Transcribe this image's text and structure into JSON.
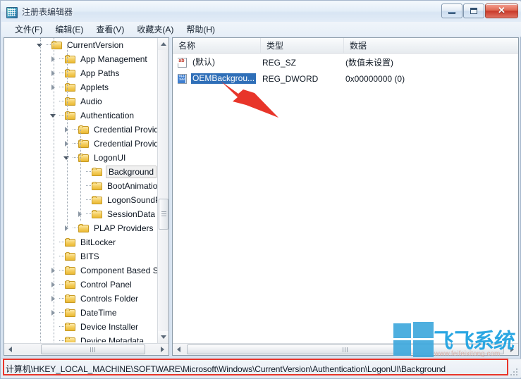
{
  "window": {
    "title": "注册表编辑器",
    "icon": "regedit-icon",
    "buttons": {
      "minimize": "最小化",
      "maximize": "最大化",
      "close": "✕"
    }
  },
  "menubar": {
    "items": [
      {
        "label": "文件(F)",
        "name": "menu-file"
      },
      {
        "label": "编辑(E)",
        "name": "menu-edit"
      },
      {
        "label": "查看(V)",
        "name": "menu-view"
      },
      {
        "label": "收藏夹(A)",
        "name": "menu-favorites"
      },
      {
        "label": "帮助(H)",
        "name": "menu-help"
      }
    ]
  },
  "tree": {
    "nodes": [
      {
        "label": "CurrentVersion",
        "depth": 1,
        "state": "expanded",
        "selected": false
      },
      {
        "label": "App Management",
        "depth": 2,
        "state": "collapsed",
        "selected": false
      },
      {
        "label": "App Paths",
        "depth": 2,
        "state": "collapsed",
        "selected": false
      },
      {
        "label": "Applets",
        "depth": 2,
        "state": "collapsed",
        "selected": false
      },
      {
        "label": "Audio",
        "depth": 2,
        "state": "leaf",
        "selected": false
      },
      {
        "label": "Authentication",
        "depth": 2,
        "state": "expanded",
        "selected": false
      },
      {
        "label": "Credential Provid",
        "depth": 3,
        "state": "collapsed",
        "selected": false
      },
      {
        "label": "Credential Provid",
        "depth": 3,
        "state": "collapsed",
        "selected": false
      },
      {
        "label": "LogonUI",
        "depth": 3,
        "state": "expanded",
        "selected": false
      },
      {
        "label": "Background",
        "depth": 4,
        "state": "leaf",
        "selected": true
      },
      {
        "label": "BootAnimatio",
        "depth": 4,
        "state": "leaf",
        "selected": false
      },
      {
        "label": "LogonSoundP",
        "depth": 4,
        "state": "leaf",
        "selected": false
      },
      {
        "label": "SessionData",
        "depth": 4,
        "state": "collapsed",
        "selected": false
      },
      {
        "label": "PLAP Providers",
        "depth": 3,
        "state": "collapsed",
        "selected": false
      },
      {
        "label": "BitLocker",
        "depth": 2,
        "state": "leaf",
        "selected": false
      },
      {
        "label": "BITS",
        "depth": 2,
        "state": "leaf",
        "selected": false
      },
      {
        "label": "Component Based S",
        "depth": 2,
        "state": "collapsed",
        "selected": false
      },
      {
        "label": "Control Panel",
        "depth": 2,
        "state": "collapsed",
        "selected": false
      },
      {
        "label": "Controls Folder",
        "depth": 2,
        "state": "collapsed",
        "selected": false
      },
      {
        "label": "DateTime",
        "depth": 2,
        "state": "collapsed",
        "selected": false
      },
      {
        "label": "Device Installer",
        "depth": 2,
        "state": "leaf",
        "selected": false
      },
      {
        "label": "Device Metadata",
        "depth": 2,
        "state": "leaf",
        "selected": false
      }
    ]
  },
  "listview": {
    "columns": [
      {
        "label": "名称",
        "name": "column-name"
      },
      {
        "label": "类型",
        "name": "column-type"
      },
      {
        "label": "数据",
        "name": "column-data"
      }
    ],
    "rows": [
      {
        "icon": "string-value-icon",
        "icon_text": "ab",
        "name": "(默认)",
        "type": "REG_SZ",
        "data": "(数值未设置)",
        "selected": false
      },
      {
        "icon": "dword-value-icon",
        "icon_text": "011 100",
        "name": "OEMBackgrou...",
        "type": "REG_DWORD",
        "data": "0x00000000 (0)",
        "selected": true
      }
    ]
  },
  "statusbar": {
    "path": "计算机\\HKEY_LOCAL_MACHINE\\SOFTWARE\\Microsoft\\Windows\\CurrentVersion\\Authentication\\LogonUI\\Background"
  },
  "watermark": {
    "text": "飞飞系统",
    "url": "www.feifeixitong.com"
  },
  "annotations": {
    "arrow_color": "#e8352a",
    "rect_color": "#e8352a"
  },
  "colors": {
    "accent": "#2f6fb8",
    "annotation": "#e8352a",
    "folder": "#f5cf62",
    "watermark_blue": "#1aa0e0"
  }
}
